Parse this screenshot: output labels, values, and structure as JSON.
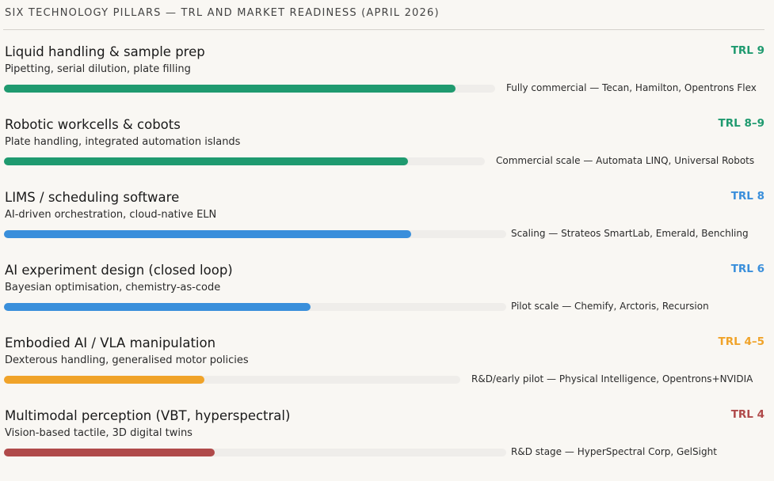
{
  "chart_data": {
    "type": "bar",
    "title": "SIX TECHNOLOGY PILLARS — TRL AND MARKET READINESS (APRIL 2026)",
    "categories": [
      "Liquid handling & sample prep",
      "Robotic workcells & cobots",
      "LIMS / scheduling software",
      "AI experiment design (closed loop)",
      "Embodied AI / VLA manipulation",
      "Multimodal perception (VBT, hyperspectral)"
    ],
    "values": [
      92,
      84,
      81,
      61,
      44,
      42
    ],
    "items": [
      {
        "title": "Liquid handling & sample prep",
        "subtitle": "Pipetting, serial dilution, plate filling",
        "trl": "TRL 9",
        "status": "Fully commercial — Tecan, Hamilton, Opentrons Flex",
        "readiness": 92,
        "color": "#1f9a6f"
      },
      {
        "title": "Robotic workcells & cobots",
        "subtitle": "Plate handling, integrated automation islands",
        "trl": "TRL 8–9",
        "status": "Commercial scale — Automata LINQ, Universal Robots",
        "readiness": 84,
        "color": "#1f9a6f"
      },
      {
        "title": "LIMS / scheduling software",
        "subtitle": "AI-driven orchestration, cloud-native ELN",
        "trl": "TRL 8",
        "status": "Scaling — Strateos SmartLab, Emerald, Benchling",
        "readiness": 81,
        "color": "#3a8fdb"
      },
      {
        "title": "AI experiment design (closed loop)",
        "subtitle": "Bayesian optimisation, chemistry-as-code",
        "trl": "TRL 6",
        "status": "Pilot scale — Chemify, Arctoris, Recursion",
        "readiness": 61,
        "color": "#3a8fdb"
      },
      {
        "title": "Embodied AI / VLA manipulation",
        "subtitle": "Dexterous handling, generalised motor policies",
        "trl": "TRL 4–5",
        "status": "R&D/early pilot — Physical Intelligence, Opentrons+NVIDIA",
        "readiness": 44,
        "color": "#f0a329"
      },
      {
        "title": "Multimodal perception (VBT, hyperspectral)",
        "subtitle": "Vision-based tactile, 3D digital twins",
        "trl": "TRL 4",
        "status": "R&D stage — HyperSpectral Corp, GelSight",
        "readiness": 42,
        "color": "#b04a4a"
      }
    ]
  }
}
